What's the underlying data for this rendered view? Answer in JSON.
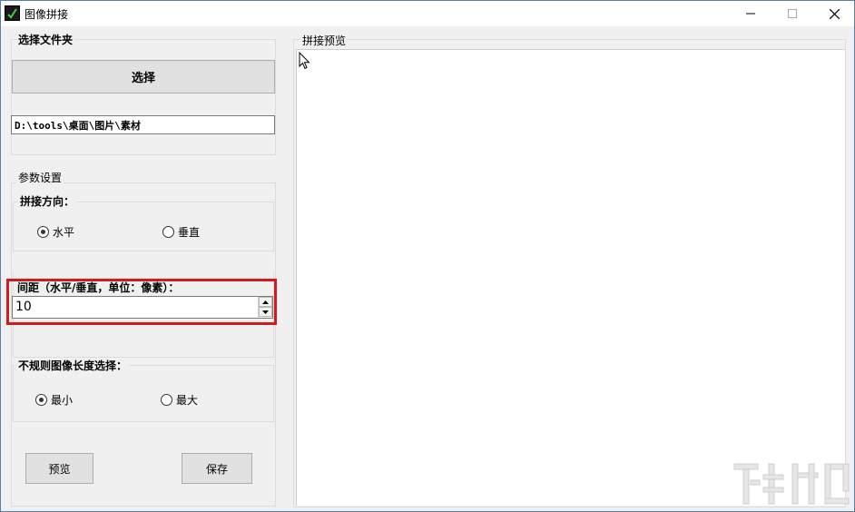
{
  "window": {
    "title": "图像拼接"
  },
  "left_panel": {
    "folder_group_title": "选择文件夹",
    "select_button_label": "选择",
    "folder_path": "D:\\tools\\桌面\\图片\\素材",
    "params_group_title": "参数设置",
    "direction_group_title": "拼接方向：",
    "direction_options": [
      {
        "label": "水平",
        "checked": true
      },
      {
        "label": "垂直",
        "checked": false
      }
    ],
    "spacing_label": "间距（水平/垂直，单位：像素）：",
    "spacing_value": "10",
    "irregular_group_title": "不规则图像长度选择：",
    "length_options": [
      {
        "label": "最小",
        "checked": true
      },
      {
        "label": "最大",
        "checked": false
      }
    ],
    "preview_button_label": "预览",
    "save_button_label": "保存"
  },
  "right_panel": {
    "preview_group_title": "拼接预览"
  },
  "colors": {
    "highlight": "#d01c1c",
    "window_bg": "#f0f0f0",
    "preview_bg": "#ffffff"
  },
  "icons": {
    "app": "app-icon",
    "minimize": "minimize-icon",
    "maximize": "maximize-icon",
    "close": "close-icon",
    "cursor": "mouse-cursor-icon",
    "spin_up": "spin-up-icon",
    "spin_down": "spin-down-icon"
  }
}
